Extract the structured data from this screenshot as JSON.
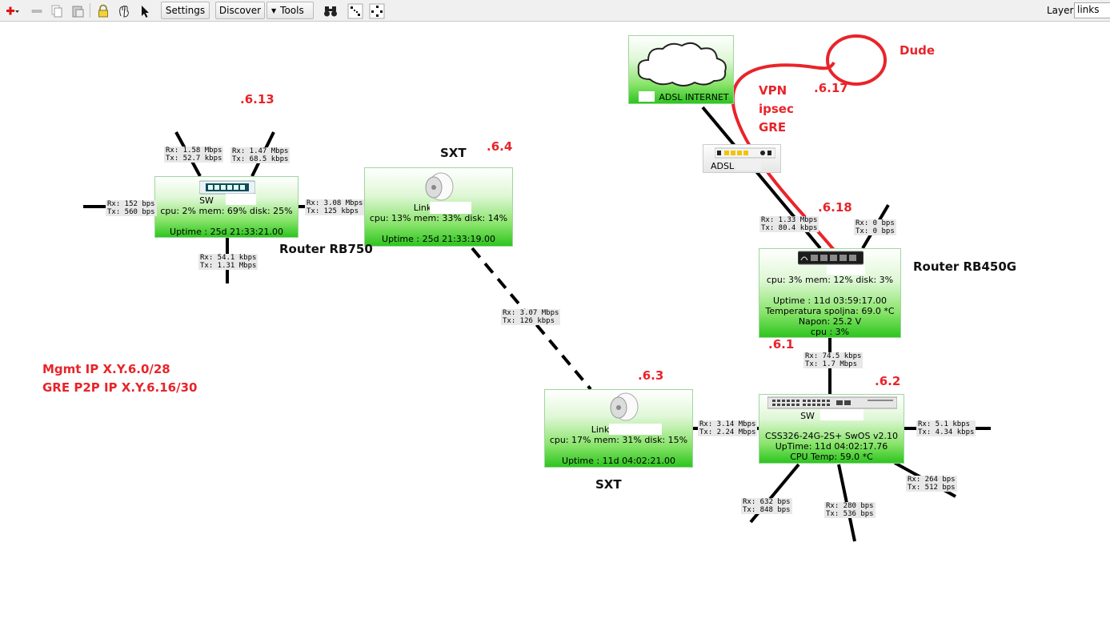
{
  "toolbar": {
    "settings_label": "Settings",
    "discover_label": "Discover",
    "tools_label": "Tools",
    "layer_label": "Layer:",
    "layer_value": "links"
  },
  "nodes": {
    "sw_left": {
      "name": "SW",
      "stats": "cpu: 2% mem: 69% disk: 25%",
      "uptime": "Uptime : 25d 21:33:21.00"
    },
    "sxt_top": {
      "name": "Link",
      "stats": "cpu: 13% mem: 33% disk: 14%",
      "uptime": "Uptime : 25d 21:33:19.00"
    },
    "sxt_bottom": {
      "name": "Link",
      "stats": "cpu: 17% mem: 31% disk: 15%",
      "uptime": "Uptime : 11d 04:02:21.00"
    },
    "internet": {
      "name": "ADSL INTERNET"
    },
    "adsl_modem": {
      "name": "ADSL"
    },
    "router_rb450g": {
      "stats": "cpu: 3% mem: 12% disk: 3%",
      "uptime": "Uptime : 11d 03:59:17.00",
      "temp": "Temperatura spoljna: 69.0 *C",
      "voltage": "Napon: 25.2 V",
      "cpu": "cpu : 3%"
    },
    "switch_css": {
      "name": "SW",
      "model": "CSS326-24G-2S+ SwOS v2.10",
      "uptime": "UpTime: 11d 04:02:17.76",
      "temp": "CPU Temp: 59.0 *C"
    }
  },
  "traffic_labels": [
    {
      "rx": "Rx: 1.58 Mbps",
      "tx": "Tx: 52.7 kbps"
    },
    {
      "rx": "Rx: 1.47 Mbps",
      "tx": "Tx: 68.5 kbps"
    },
    {
      "rx": "Rx: 152 bps",
      "tx": "Tx: 560 bps"
    },
    {
      "rx": "Rx: 3.08 Mbps",
      "tx": "Tx: 125 kbps"
    },
    {
      "rx": "Rx: 54.1 kbps",
      "tx": "Tx: 1.31 Mbps"
    },
    {
      "rx": "Rx: 3.07 Mbps",
      "tx": "Tx: 126 kbps"
    },
    {
      "rx": "Rx: 1.33 Mbps",
      "tx": "Tx: 80.4 kbps"
    },
    {
      "rx": "Rx: 0 bps",
      "tx": "Tx: 0 bps"
    },
    {
      "rx": "Rx: 74.5 kbps",
      "tx": "Tx: 1.7 Mbps"
    },
    {
      "rx": "Rx: 3.14 Mbps",
      "tx": "Tx: 2.24 Mbps"
    },
    {
      "rx": "Rx: 5.1 kbps",
      "tx": "Tx: 4.34 kbps"
    },
    {
      "rx": "Rx: 264 bps",
      "tx": "Tx: 512 bps"
    },
    {
      "rx": "Rx: 632 bps",
      "tx": "Tx: 848 bps"
    },
    {
      "rx": "Rx: 280 bps",
      "tx": "Tx: 536 bps"
    }
  ],
  "labels": {
    "ip_613": ".6.13",
    "sxt_top": "SXT",
    "ip_64": ".6.4",
    "router_rb750": "Router RB750",
    "dude": "Dude",
    "vpn": "VPN",
    "ipsec": "ipsec",
    "gre": "GRE",
    "ip_617": ".6.17",
    "ip_618": ".6.18",
    "router_rb450g": "Router RB450G",
    "ip_61": ".6.1",
    "ip_62": ".6.2",
    "ip_63": ".6.3",
    "sxt_bottom": "SXT",
    "mgmt_ip": "Mgmt IP X.Y.6.0/28",
    "gre_p2p": "GRE P2P IP X.Y.6.16/30"
  },
  "colors": {
    "node_green": "#2dc51e",
    "annotation_red": "#e8242a",
    "link_black": "#000000"
  }
}
